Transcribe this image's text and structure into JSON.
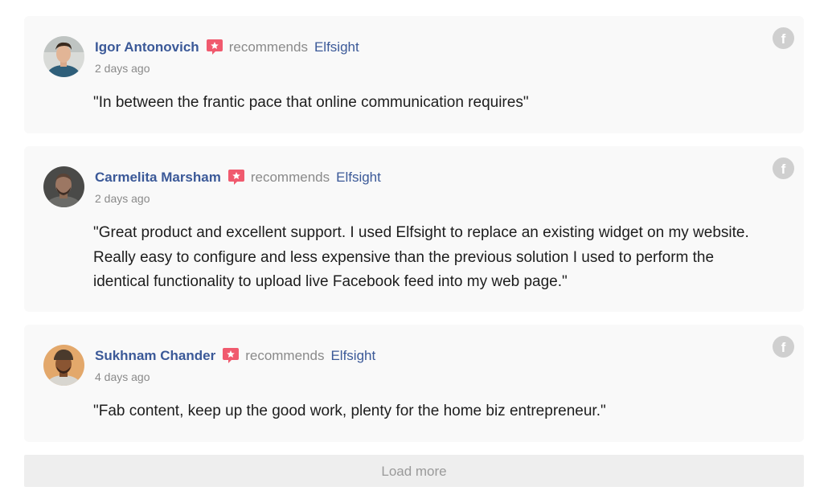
{
  "colors": {
    "author": "#3b5998",
    "muted": "#8a8a8a",
    "badge": "#f05a6e",
    "card_bg": "#f9f9f9"
  },
  "reviews": [
    {
      "author": "Igor Antonovich",
      "badge_icon": "recommend-star-icon",
      "action": "recommends",
      "page": "Elfsight",
      "time": "2 days ago",
      "text": "\"In between the frantic pace that online communication requires\"",
      "source_icon": "facebook-icon"
    },
    {
      "author": "Carmelita Marsham",
      "badge_icon": "recommend-star-icon",
      "action": "recommends",
      "page": "Elfsight",
      "time": "2 days ago",
      "text": "\"Great product and excellent support. I used Elfsight to replace an existing widget on my website. Really easy to configure and less expensive than the previous solution I used to perform the identical functionality to upload live Facebook feed into my web page.\"",
      "source_icon": "facebook-icon"
    },
    {
      "author": "Sukhnam Chander",
      "badge_icon": "recommend-star-icon",
      "action": "recommends",
      "page": "Elfsight",
      "time": "4 days ago",
      "text": "\"Fab content, keep up the good work, plenty for the home biz entrepreneur.\"",
      "source_icon": "facebook-icon"
    }
  ],
  "load_more_label": "Load more",
  "facebook_glyph": "f"
}
